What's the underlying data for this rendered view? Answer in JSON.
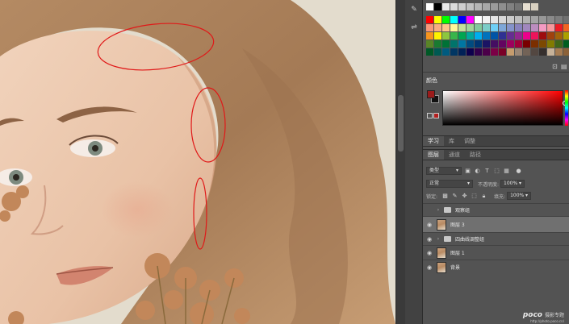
{
  "panels": {
    "color_tab": "颜色",
    "mid_tabs": [
      "学习",
      "库",
      "调整"
    ],
    "layer_tabs": [
      "图层",
      "通道",
      "路径"
    ],
    "filter_kind": "类型",
    "blend_mode": "正常",
    "opacity_label": "不透明度:",
    "opacity_value": "100%",
    "lock_label": "锁定:",
    "fill_label": "填充:",
    "fill_value": "100%"
  },
  "colors": {
    "foreground": "#9b1b1b",
    "background": "#111111",
    "swatch_row1": [
      "#ffffff",
      "#000000",
      "#ebebeb",
      "#dcdcdc",
      "#cfcfcf",
      "#c2c2c2",
      "#b5b5b5",
      "#a8a8a8",
      "#9b9b9b",
      "#8e8e8e",
      "#818181",
      "#747474",
      "#e6dfd1",
      "#d8d0c0"
    ],
    "swatch_row2": [
      "#ff0000",
      "#ffff00",
      "#00ff00",
      "#00ffff",
      "#0000ff",
      "#ff00ff",
      "#ffffff",
      "#f2f2f2",
      "#e5e5e5",
      "#d8d8d8",
      "#cbcbcb",
      "#bebebe",
      "#b1b1b1",
      "#a4a4a4",
      "#979797",
      "#8a8a8a",
      "#7d7d7d",
      "#707070"
    ],
    "swatch_row3": [
      "#f7977a",
      "#f9ad81",
      "#fdc68a",
      "#fff79a",
      "#c4df9b",
      "#a3d39c",
      "#82ca9d",
      "#7bcdc8",
      "#6ecff6",
      "#7ea7d8",
      "#8493ca",
      "#8882be",
      "#a187be",
      "#bc8dbf",
      "#f49ac2",
      "#f6989d",
      "#ed1c24",
      "#f26522"
    ],
    "swatch_row4": [
      "#f7941d",
      "#fff200",
      "#8dc63f",
      "#39b54a",
      "#00a651",
      "#00a99d",
      "#00aeef",
      "#0072bc",
      "#0054a6",
      "#2e3192",
      "#662d91",
      "#92278f",
      "#ec008c",
      "#ed145b",
      "#9e0b0f",
      "#a0410d",
      "#a3620a",
      "#aba000"
    ],
    "swatch_row5": [
      "#598527",
      "#197b30",
      "#007236",
      "#00746b",
      "#0076a3",
      "#004b80",
      "#003471",
      "#1b1464",
      "#440e62",
      "#630460",
      "#9e005d",
      "#9e0039",
      "#790000",
      "#7b2e00",
      "#7d4900",
      "#827b00",
      "#406618",
      "#005e20"
    ],
    "swatch_row6": [
      "#005826",
      "#005952",
      "#005b7f",
      "#003663",
      "#002157",
      "#0d004c",
      "#32004b",
      "#4b0049",
      "#7b0046",
      "#7a0026",
      "#c69c6d",
      "#998675",
      "#736357",
      "#534741",
      "#362f2d",
      "#c7b299",
      "#a67c52",
      "#8c6239"
    ]
  },
  "layers": [
    {
      "name": "观察组",
      "type": "group",
      "visible": false,
      "selected": false
    },
    {
      "name": "图层 3",
      "type": "pixel",
      "visible": true,
      "selected": true
    },
    {
      "name": "四曲线调整组",
      "type": "group",
      "visible": true,
      "selected": false
    },
    {
      "name": "图层 1",
      "type": "pixel",
      "visible": true,
      "selected": false
    },
    {
      "name": "背景",
      "type": "pixel",
      "visible": true,
      "selected": false
    }
  ],
  "watermark": {
    "brand": "poco",
    "tag": "摄影专题",
    "url": "http://photo.poco.cn/"
  },
  "icons": [
    "eye-icon",
    "folder-icon",
    "caret-icon",
    "filter-pixel-icon",
    "filter-adjust-icon",
    "filter-text-icon",
    "filter-shape-icon",
    "filter-smart-icon",
    "lock-pixel-icon",
    "lock-move-icon",
    "lock-all-icon"
  ]
}
